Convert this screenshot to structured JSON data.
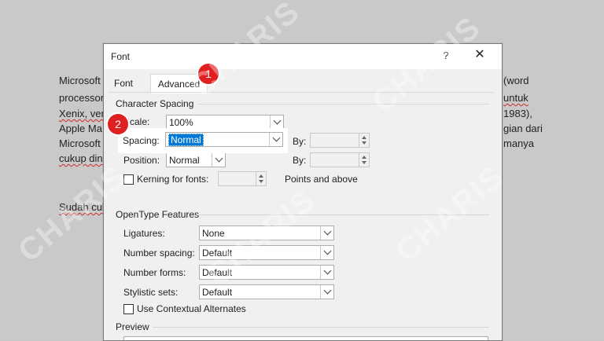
{
  "document": {
    "lines": [
      {
        "left": "Microsoft",
        "right": "(word"
      },
      {
        "left": "processor",
        "right": "untuk"
      },
      {
        "left": "Xenix, ver",
        "right": "1983),"
      },
      {
        "left": "Apple Ma",
        "right": "gian dari"
      },
      {
        "left": "Microsoft",
        "right": "manya"
      },
      {
        "left": "cukup din",
        "right": ""
      },
      {
        "left": "Sudah cuk",
        "right": ""
      }
    ]
  },
  "dialog": {
    "title": "Font",
    "help": "?",
    "close": "✕",
    "tabs": {
      "font": "Font",
      "advanced": "Advanced"
    },
    "character_spacing": {
      "section_title": "Character Spacing",
      "scale_label": "Scale:",
      "scale_value": "100%",
      "spacing_label": "Spacing:",
      "spacing_value": "Normal",
      "spacing_by_label": "By:",
      "position_label": "Position:",
      "position_value": "Normal",
      "position_by_label": "By:",
      "kerning_label": "Kerning for fonts:",
      "kerning_suffix": "Points and above"
    },
    "opentype": {
      "section_title": "OpenType Features",
      "ligatures_label": "Ligatures:",
      "ligatures_value": "None",
      "number_spacing_label": "Number spacing:",
      "number_spacing_value": "Default",
      "number_forms_label": "Number forms:",
      "number_forms_value": "Default",
      "stylistic_sets_label": "Stylistic sets:",
      "stylistic_sets_value": "Default",
      "contextual_alternates_label": "Use Contextual Alternates"
    },
    "preview": {
      "section_title": "Preview"
    }
  },
  "annotations": {
    "badge1": "1",
    "badge2": "2",
    "badge_color": "#e02020"
  },
  "watermark": "CHARIS"
}
